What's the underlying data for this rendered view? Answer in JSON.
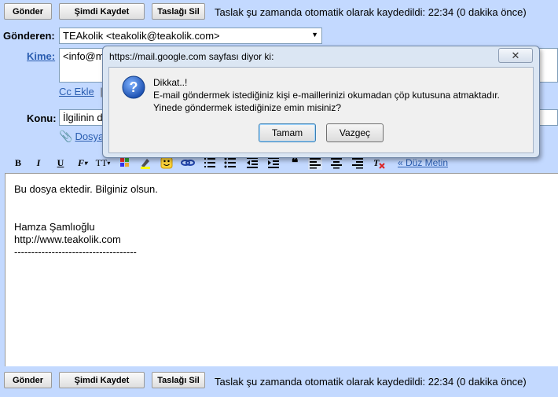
{
  "top_bar": {
    "send_label": "Gönder",
    "save_now_label": "Şimdi Kaydet",
    "discard_draft_label": "Taslağı Sil",
    "status": "Taslak şu zamanda otomatik olarak kaydedildi: 22:34 (0 dakika önce)"
  },
  "compose": {
    "from_label": "Gönderen:",
    "from_value": "TEAkolik <teakolik@teakolik.com>",
    "to_label": "Kime:",
    "to_value": "<info@m",
    "cc_label": "Cc Ekle",
    "cc_separator": "|",
    "subject_label": "Konu:",
    "subject_value": "İlgilinin d",
    "attach_label": "Dosya"
  },
  "toolbar": {
    "plain_text_label": "« Düz Metin"
  },
  "body": {
    "line1": "Bu dosya ektedir. Bilginiz olsun.",
    "name": "Hamza Şamlıoğlu",
    "url": "http://www.teakolik.com",
    "separator": "------------------------------------"
  },
  "dialog": {
    "title": "https://mail.google.com sayfası diyor ki:",
    "close": "✕",
    "heading": "Dikkat..!",
    "message1": "E-mail göndermek istediğiniz kişi e-maillerinizi okumadan çöp kutusuna atmaktadır.",
    "message2": "Yinede göndermek istediğinize emin misiniz?",
    "ok_label": "Tamam",
    "cancel_label": "Vazgeç"
  },
  "bottom_bar": {
    "send_label": "Gönder",
    "save_now_label": "Şimdi Kaydet",
    "discard_draft_label": "Taslağı Sil",
    "status": "Taslak şu zamanda otomatik olarak kaydedildi: 22:34 (0 dakika önce)"
  },
  "colors": {
    "background": "#c3d9ff",
    "link": "#2a5db0",
    "dialog": "#dbe6f3",
    "info_icon": "#2a63c4"
  }
}
